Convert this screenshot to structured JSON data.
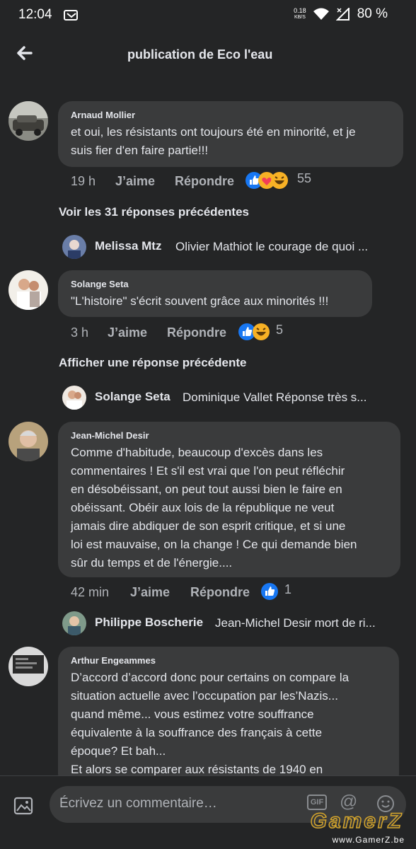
{
  "status": {
    "time": "12:04",
    "net_speed": "0.18",
    "net_unit": "KB/S",
    "battery": "80 %"
  },
  "header": {
    "title": "publication de Eco l'eau"
  },
  "labels": {
    "like": "J’aime",
    "reply": "Répondre"
  },
  "comments": [
    {
      "author": "Arnaud Mollier",
      "lines": [
        "et oui, les résistants ont toujours été en minorité, et je",
        "suis fier d'en faire partie!!!"
      ],
      "time": "19 h",
      "reactions": [
        "like",
        "love",
        "haha"
      ],
      "count": "55"
    },
    {
      "author": "Solange Seta",
      "lines": [
        "\"L'histoire\" s'écrit souvent grâce aux minorités !!!"
      ],
      "time": "3 h",
      "reactions": [
        "like",
        "haha"
      ],
      "count": "5"
    },
    {
      "author": "Jean-Michel Desir",
      "lines": [
        "Comme d'habitude, beaucoup d'excès dans les",
        "commentaires ! Et s'il est vrai que l'on peut réfléchir",
        "en désobéissant, on peut tout aussi bien le faire en",
        "obéissant. Obéir aux lois de la république ne veut",
        "jamais dire abdiquer de son esprit critique, et si une",
        "loi est mauvaise, on la change ! Ce qui demande bien",
        "sûr du temps et de l'énergie...."
      ],
      "time": "42 min",
      "reactions": [
        "like"
      ],
      "count": "1"
    },
    {
      "author": "Arthur Engeammes",
      "lines": [
        "D’accord d’accord donc pour certains on compare la",
        "situation actuelle avec l’occupation par les’Nazis...",
        "quand même... vous estimez votre souffrance",
        "équivalente à la souffrance des français à cette",
        "époque? Et bah...",
        "Et alors se comparer aux résistants de 1940 en"
      ]
    }
  ],
  "see_more": [
    "Voir les 31 réponses précédentes",
    "Afficher une réponse précédente"
  ],
  "replies": [
    {
      "name": "Melissa Mtz",
      "text": "Olivier Mathiot le courage de quoi ..."
    },
    {
      "name": "Solange Seta",
      "text": "Dominique Vallet  Réponse très s..."
    },
    {
      "name": "Philippe Boscherie",
      "text": "Jean-Michel Desir mort de ri..."
    }
  ],
  "composer": {
    "placeholder": "Écrivez un commentaire…",
    "gif": "GIF",
    "mention": "@"
  },
  "watermark": {
    "logo": "GamerZ",
    "url": "www.GamerZ.be"
  },
  "colors": {
    "background": "#242526",
    "bubble": "#3a3b3c",
    "text": "#e4e6eb",
    "secondary": "#b0b3b8",
    "like_blue": "#1877f2",
    "love_red": "#f33e58",
    "haha_yellow": "#f7b125"
  }
}
